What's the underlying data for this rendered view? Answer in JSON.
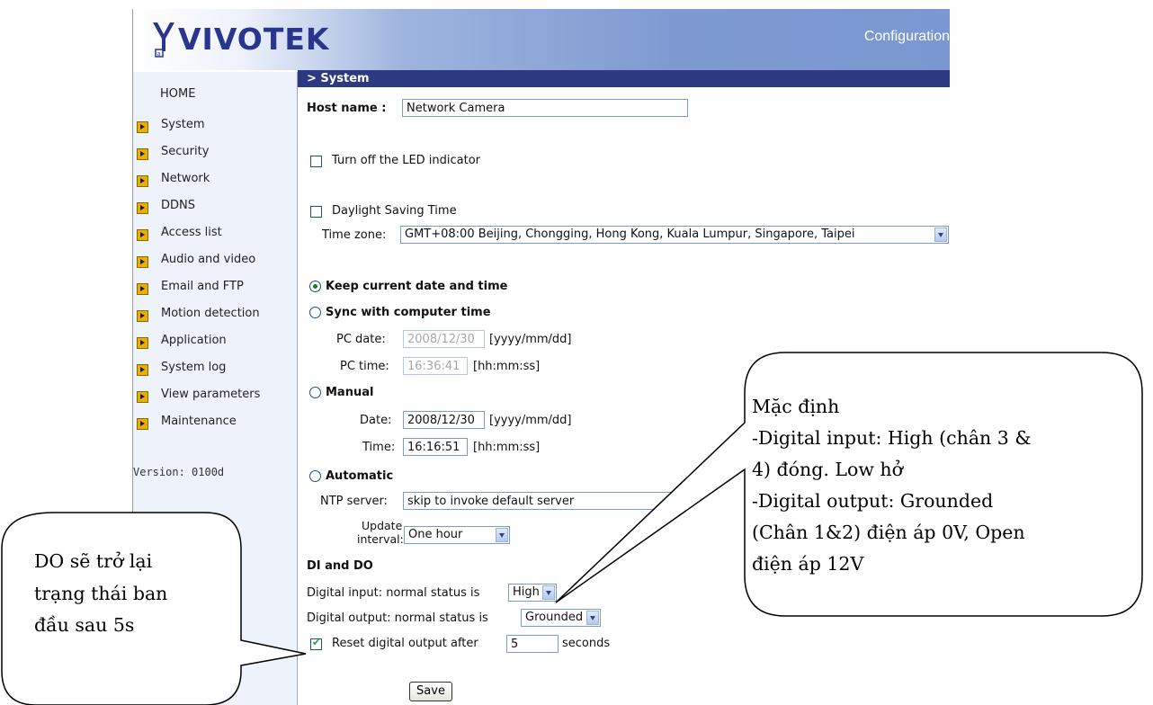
{
  "header": {
    "logo_text": "VIVOTEK",
    "title": "Configuration"
  },
  "sidebar": {
    "home": "HOME",
    "items": [
      "System",
      "Security",
      "Network",
      "DDNS",
      "Access list",
      "Audio and video",
      "Email and FTP",
      "Motion detection",
      "Application",
      "System log",
      "View parameters",
      "Maintenance"
    ],
    "version": "Version: 0100d"
  },
  "main": {
    "section_title": "> System",
    "host_name_label": "Host name :",
    "host_name_value": "Network Camera",
    "led_label": "Turn off the LED indicator",
    "dst_label": "Daylight Saving Time",
    "timezone_label": "Time zone:",
    "timezone_value": "GMT+08:00 Beijing, Chongging, Hong Kong, Kuala Lumpur, Singapore, Taipei",
    "keep_label": "Keep current date and time",
    "sync_label": "Sync with computer time",
    "pc_date_label": "PC date:",
    "pc_date_value": "2008/12/30",
    "pc_date_hint": "[yyyy/mm/dd]",
    "pc_time_label": "PC time:",
    "pc_time_value": "16:36:41",
    "pc_time_hint": "[hh:mm:ss]",
    "manual_label": "Manual",
    "date_label": "Date:",
    "date_value": "2008/12/30",
    "date_hint": "[yyyy/mm/dd]",
    "time_label": "Time:",
    "time_value": "16:16:51",
    "time_hint": "[hh:mm:ss]",
    "automatic_label": "Automatic",
    "ntp_label": "NTP server:",
    "ntp_value": "skip to invoke default server",
    "update_label_1": "Update",
    "update_label_2": "interval:",
    "update_value": "One hour",
    "dido_title": "DI and DO",
    "di_label": "Digital input: normal status is",
    "di_value": "High",
    "do_label": "Digital output: normal status is",
    "do_value": "Grounded",
    "reset_label": "Reset digital output after",
    "reset_value": "5",
    "reset_unit": "seconds",
    "save_label": "Save",
    "led_checked": false,
    "dst_checked": false,
    "reset_checked": true,
    "selected_time_mode": "Keep current date and time"
  },
  "callouts": {
    "left": [
      "DO sẽ trở lại",
      "trạng thái ban",
      "đầu sau 5s"
    ],
    "right": [
      "Mặc định",
      "-Digital input: High (chân 3 &",
      "4) đóng. Low hở",
      "-Digital output: Grounded",
      "(Chân 1&2) điện áp 0V, Open",
      "điện áp 12V"
    ]
  },
  "colors": {
    "section_bar": "#2d3a82",
    "sidebar_bg": "#eef2fb",
    "header_gradient_end": "#7b97d1",
    "logo": "#2a3590"
  }
}
